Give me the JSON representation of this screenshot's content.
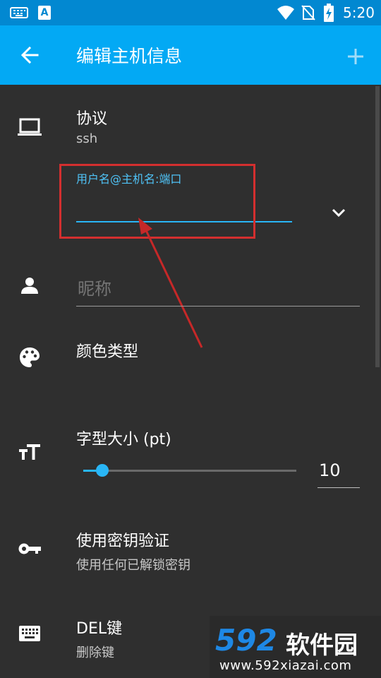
{
  "status_bar": {
    "time": "5:20",
    "notif_icon_letter": "A"
  },
  "app_bar": {
    "title": "编辑主机信息"
  },
  "form": {
    "protocol": {
      "label": "协议",
      "value": "ssh"
    },
    "host_field": {
      "hint": "用户名@主机名:端口",
      "value": ""
    },
    "nickname": {
      "placeholder": "昵称"
    },
    "color_type": {
      "label": "颜色类型"
    },
    "font_size": {
      "label": "字型大小 (pt)",
      "value": "10",
      "slider_fraction": 0.06
    },
    "use_key": {
      "label": "使用密钥验证",
      "sub": "使用任何已解锁密钥"
    },
    "del_key": {
      "label": "DEL键",
      "sub": "删除键"
    }
  },
  "watermark": {
    "logo": "592",
    "name": "软件园",
    "url": "www.592xiazai.com"
  },
  "colors": {
    "appbar": "#03a9f4",
    "statusbar": "#0288d1",
    "background": "#2f2f2f",
    "accent": "#29b6f6",
    "highlight_box": "#d32f2f"
  }
}
